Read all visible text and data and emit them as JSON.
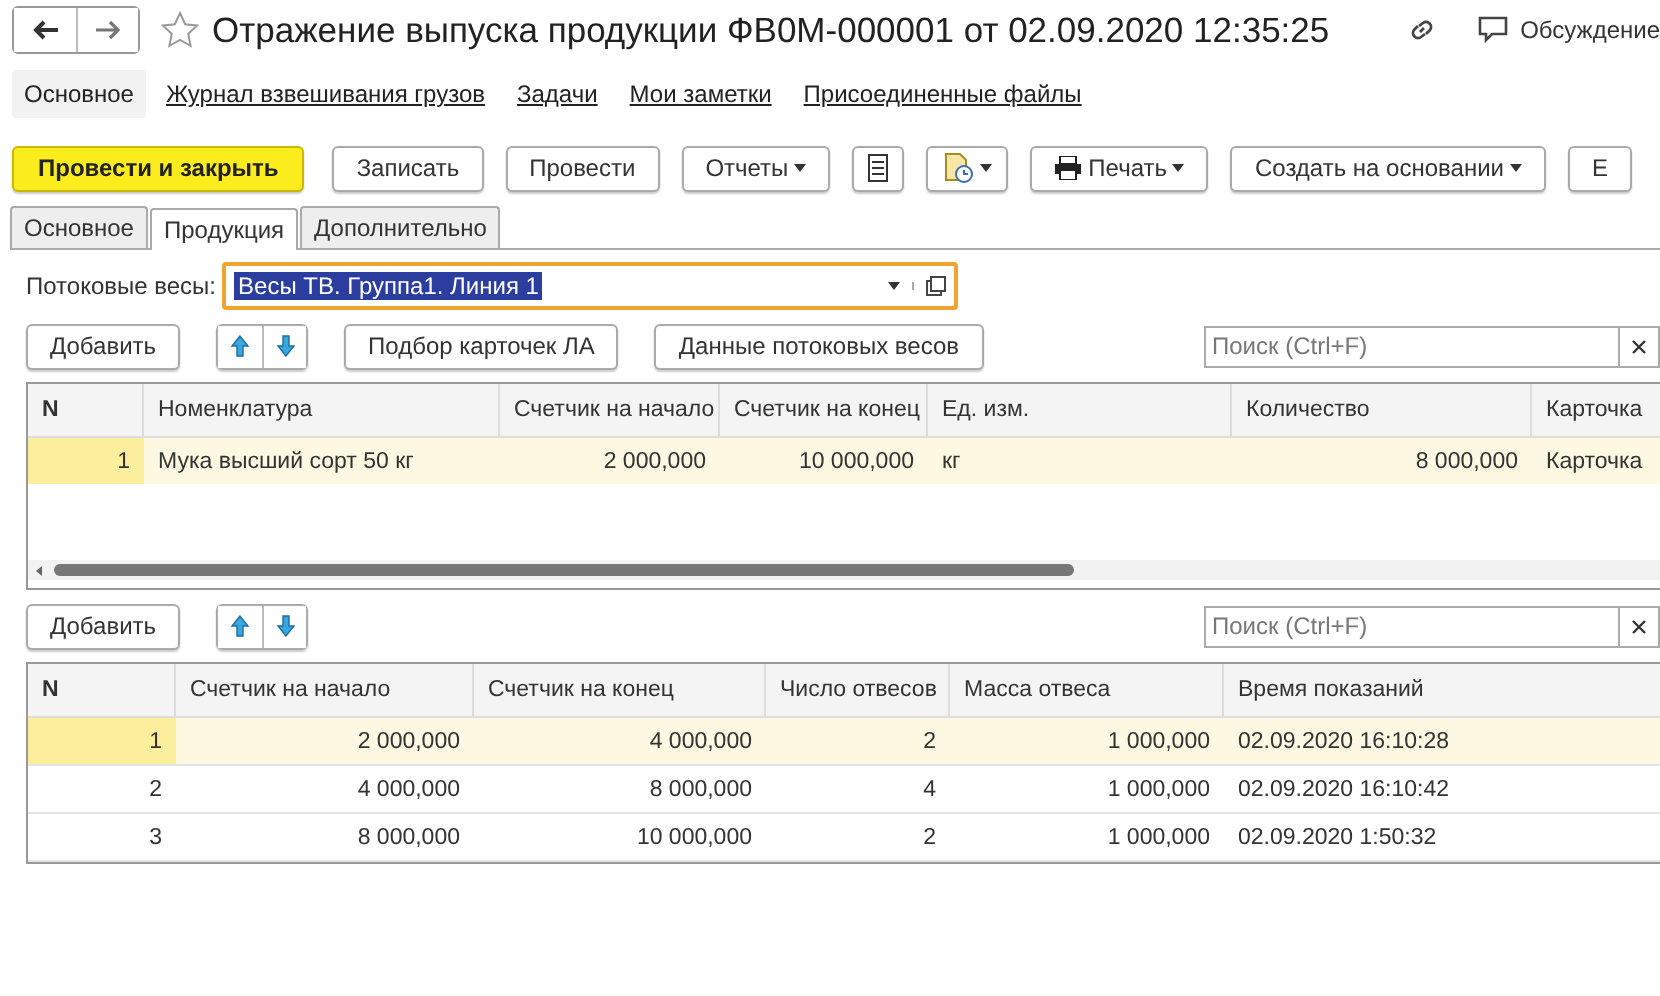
{
  "window": {
    "title": "Отражение выпуска продукции ФВ0М-000001 от 02.09.2020 12:35:25",
    "discussion": "Обсуждение"
  },
  "nav": [
    {
      "label": "Основное",
      "selected": true
    },
    {
      "label": "Журнал взвешивания грузов",
      "selected": false
    },
    {
      "label": "Задачи",
      "selected": false
    },
    {
      "label": "Мои заметки",
      "selected": false
    },
    {
      "label": "Присоединенные файлы",
      "selected": false
    }
  ],
  "toolbar": [
    {
      "kind": "primary",
      "label": "Провести и закрыть"
    },
    {
      "kind": "button",
      "label": "Записать"
    },
    {
      "kind": "button",
      "label": "Провести"
    },
    {
      "kind": "dropdown",
      "label": "Отчеты"
    },
    {
      "kind": "list-icon"
    },
    {
      "kind": "doc-dropdown"
    },
    {
      "kind": "print",
      "label": "Печать"
    },
    {
      "kind": "dropdown",
      "label": "Создать на основании"
    },
    {
      "kind": "button",
      "label": "Е"
    }
  ],
  "tabs": [
    {
      "label": "Основное",
      "selected": false
    },
    {
      "label": "Продукция",
      "selected": true
    },
    {
      "label": "Дополнительно",
      "selected": false
    }
  ],
  "scales": {
    "label": "Потоковые весы:",
    "value": "Весы ТВ. Группа1. Линия 1"
  },
  "table1": {
    "buttons": [
      "Добавить",
      "Подбор карточек ЛА",
      "Данные потоковых весов"
    ],
    "search": {
      "placeholder": "Поиск (Ctrl+F)"
    },
    "columns": [
      "N",
      "Номенклатура",
      "Счетчик на начало",
      "Счетчик на конец",
      "Ед. изм.",
      "Количество",
      "Карточка"
    ],
    "rows": [
      {
        "selected": true,
        "cells": [
          "1",
          "Мука высший сорт 50 кг",
          "2 000,000",
          "10 000,000",
          "кг",
          "8 000,000",
          "Карточка"
        ]
      }
    ]
  },
  "table2": {
    "buttons": [
      "Добавить"
    ],
    "search": {
      "placeholder": "Поиск (Ctrl+F)"
    },
    "columns": [
      "N",
      "Счетчик на начало",
      "Счетчик на конец",
      "Число отвесов",
      "Масса отвеса",
      "Время показаний"
    ],
    "rows": [
      {
        "selected": true,
        "cells": [
          "1",
          "2 000,000",
          "4 000,000",
          "2",
          "1 000,000",
          "02.09.2020 16:10:28"
        ]
      },
      {
        "selected": false,
        "cells": [
          "2",
          "4 000,000",
          "8 000,000",
          "4",
          "1 000,000",
          "02.09.2020 16:10:42"
        ]
      },
      {
        "selected": false,
        "cells": [
          "3",
          "8 000,000",
          "10 000,000",
          "2",
          "1 000,000",
          "02.09.2020 1:50:32"
        ]
      }
    ]
  }
}
